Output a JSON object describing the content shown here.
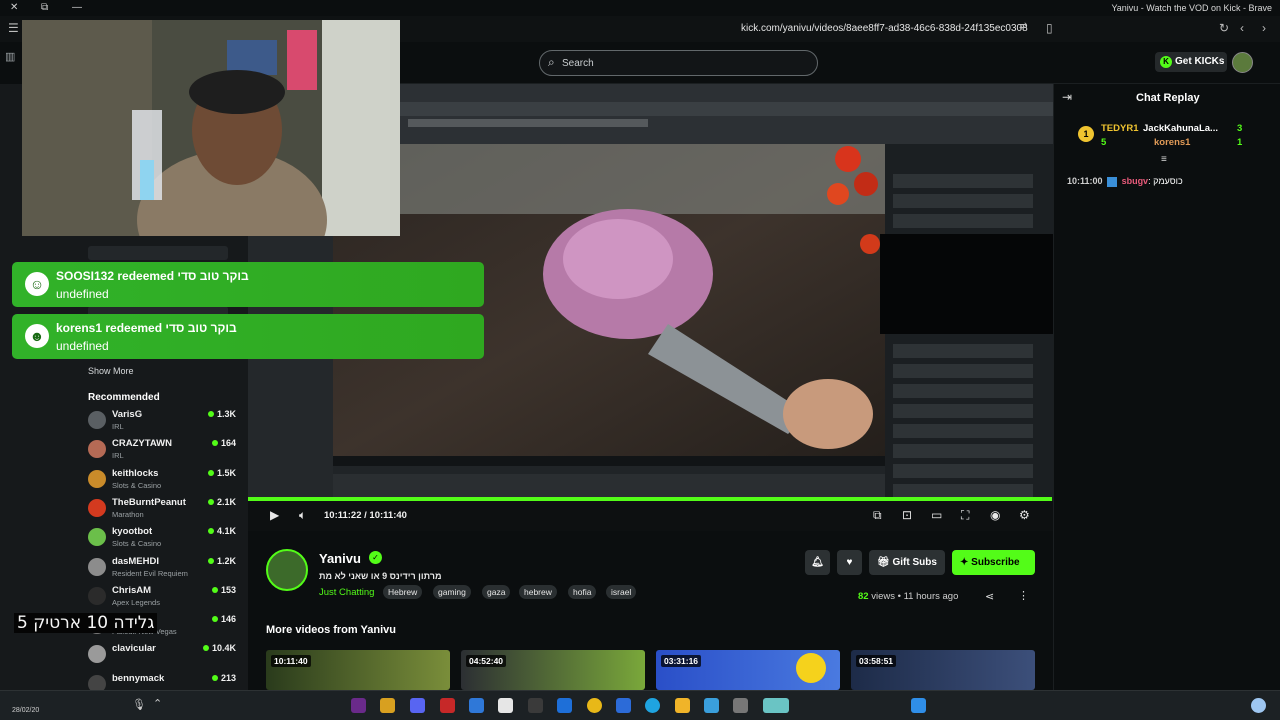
{
  "window": {
    "title": "Yanivu - Watch the VOD on Kick - Brave",
    "url": "kick.com/yanivu/videos/8aee8ff7-ad38-46c6-838d-24f135ec0308"
  },
  "header": {
    "search_placeholder": "Search",
    "get_kicks_label": "Get KICKs"
  },
  "sidebar": {
    "show_more": "Show More",
    "recommended_title": "Recommended",
    "recommended": [
      {
        "name": "VarisG",
        "category": "IRL",
        "viewers": "1.3K",
        "avatar_color": "#5a5f63"
      },
      {
        "name": "CRAZYTAWN",
        "category": "IRL",
        "viewers": "164",
        "avatar_color": "#b56a55"
      },
      {
        "name": "keithlocks",
        "category": "Slots & Casino",
        "viewers": "1.5K",
        "avatar_color": "#c98b2a"
      },
      {
        "name": "TheBurntPeanut",
        "category": "Marathon",
        "viewers": "2.1K",
        "avatar_color": "#d43a1f"
      },
      {
        "name": "kyootbot",
        "category": "Slots & Casino",
        "viewers": "4.1K",
        "avatar_color": "#6bbf4a"
      },
      {
        "name": "dasMEHDI",
        "category": "Resident Evil Requiem",
        "viewers": "1.2K",
        "avatar_color": "#8c8c8c"
      },
      {
        "name": "ChrisAM",
        "category": "Apex Legends",
        "viewers": "153",
        "avatar_color": "#2b2b2b"
      },
      {
        "name": "",
        "category": "Fallout: New Vegas",
        "viewers": "146",
        "avatar_color": "#777777"
      },
      {
        "name": "clavicular",
        "category": "",
        "viewers": "10.4K",
        "avatar_color": "#9a9a9a"
      },
      {
        "name": "bennymack",
        "category": "",
        "viewers": "213",
        "avatar_color": "#444444"
      }
    ]
  },
  "alerts": [
    {
      "line1": "SOOSI132 redeemed בוקר טוב סדי",
      "line2": "undefined"
    },
    {
      "line1": "korens1 redeemed בוקר טוב סדי",
      "line2": "undefined"
    }
  ],
  "player": {
    "time_display": "10:11:22 / 10:11:40",
    "progress_fraction": 0.999
  },
  "chat": {
    "title": "Chat Replay",
    "gifters": [
      {
        "name": "TEDYR1",
        "count": "5"
      },
      {
        "name": "JackKahunaLa...",
        "count": "3"
      },
      {
        "name": "korens1",
        "count": "1"
      }
    ],
    "messages": [
      {
        "time": "10:11:00",
        "user": "sbugv",
        "text": "כוסעמק"
      }
    ]
  },
  "channel": {
    "name": "Yanivu",
    "stream_title": "מרתון רידינס 9 או שאני לא מת",
    "category": "Just Chatting",
    "tags": [
      "Hebrew",
      "gaming",
      "gaza",
      "hebrew",
      "hofia",
      "israel"
    ],
    "views": "82",
    "views_label": "views",
    "age": "11 hours ago",
    "gift_subs_label": "Gift Subs",
    "subscribe_label": "Subscribe"
  },
  "more_videos": {
    "title": "More videos from Yanivu",
    "items": [
      {
        "duration": "10:11:40"
      },
      {
        "duration": "04:52:40"
      },
      {
        "duration": "03:31:16"
      },
      {
        "duration": "03:58:51"
      }
    ]
  },
  "overlay_text": "5 גלידה 10 ארטיק",
  "taskbar": {
    "date": "28/02/20"
  }
}
